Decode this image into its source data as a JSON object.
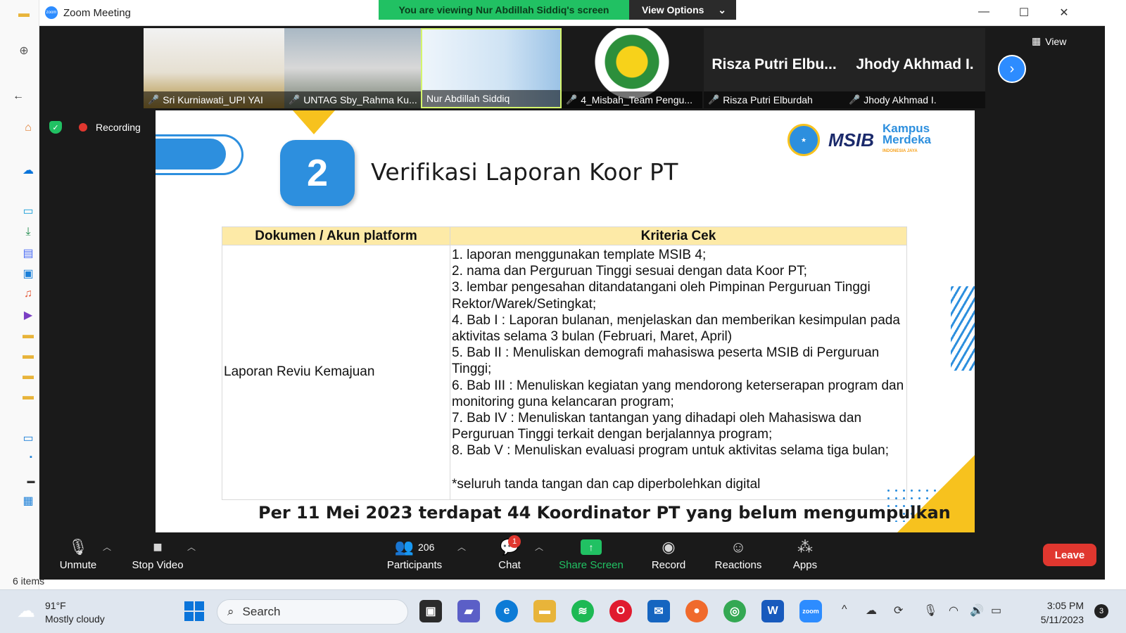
{
  "window": {
    "title": "Zoom Meeting"
  },
  "banner": {
    "viewing": "You are viewing Nur Abdillah Siddiq's screen",
    "view_options": "View Options"
  },
  "gallery": {
    "view_label": "View",
    "participants": [
      {
        "name": "Sri Kurniawati_UPI YAI",
        "muted": true,
        "video": true,
        "color": "#c9a34a"
      },
      {
        "name": "UNTAG Sby_Rahma Ku...",
        "muted": true,
        "video": true,
        "color": "#7d8a8f"
      },
      {
        "name": "Nur Abdillah Siddiq",
        "muted": false,
        "video": true,
        "active": true,
        "color": "#6aa3d8"
      },
      {
        "name": "4_Misbah_Team Pengu...",
        "muted": true,
        "video": true,
        "color": "#ffffff"
      },
      {
        "name": "Risza Putri Elburdah",
        "display_name": "Risza Putri Elbu...",
        "muted": true,
        "video": false
      },
      {
        "name": "Jhody Akhmad I.",
        "display_name": "Jhody Akhmad I.",
        "muted": true,
        "video": false
      }
    ]
  },
  "recording": {
    "label": "Recording"
  },
  "slide": {
    "number": "2",
    "title": "Verifikasi Laporan Koor PT",
    "logos": {
      "msib": "MSIB",
      "kampus_line1": "Kampus",
      "kampus_line2": "Merdeka",
      "kampus_sub": "INDONESIA JAYA"
    },
    "table": {
      "headers": [
        "Dokumen / Akun platform",
        "Kriteria Cek"
      ],
      "document": "Laporan Reviu Kemajuan",
      "criteria": [
        "1. laporan menggunakan template MSIB 4;",
        "2. nama dan Perguruan Tinggi sesuai dengan data Koor PT;",
        "3. lembar pengesahan ditandatangani oleh Pimpinan Perguruan Tinggi Rektor/Warek/Setingkat;",
        "4. Bab I : Laporan bulanan, menjelaskan dan memberikan kesimpulan pada aktivitas selama 3 bulan (Februari, Maret, April)",
        "5. Bab II : Menuliskan demografi mahasiswa peserta MSIB di Perguruan Tinggi;",
        "6. Bab III : Menuliskan kegiatan yang mendorong keterserapan program dan monitoring guna kelancaran program;",
        "7. Bab IV : Menuliskan tantangan yang dihadapi oleh Mahasiswa dan Perguruan Tinggi terkait dengan berjalannya program;",
        "8. Bab V : Menuliskan evaluasi program untuk aktivitas selama tiga bulan;"
      ],
      "note": "*seluruh tanda tangan dan cap diperbolehkan digital"
    },
    "footer": "Per 11 Mei 2023 terdapat 44 Koordinator PT yang belum mengumpulkan"
  },
  "controls": {
    "unmute": "Unmute",
    "stop_video": "Stop Video",
    "participants": "Participants",
    "participants_count": "206",
    "chat": "Chat",
    "chat_badge": "1",
    "share_screen": "Share Screen",
    "record": "Record",
    "reactions": "Reactions",
    "apps": "Apps",
    "leave": "Leave"
  },
  "explorer": {
    "status": "6 items"
  },
  "taskbar": {
    "weather_temp": "91°F",
    "weather_desc": "Mostly cloudy",
    "search_placeholder": "Search",
    "time": "3:05 PM",
    "date": "5/11/2023",
    "notifications": "3"
  }
}
